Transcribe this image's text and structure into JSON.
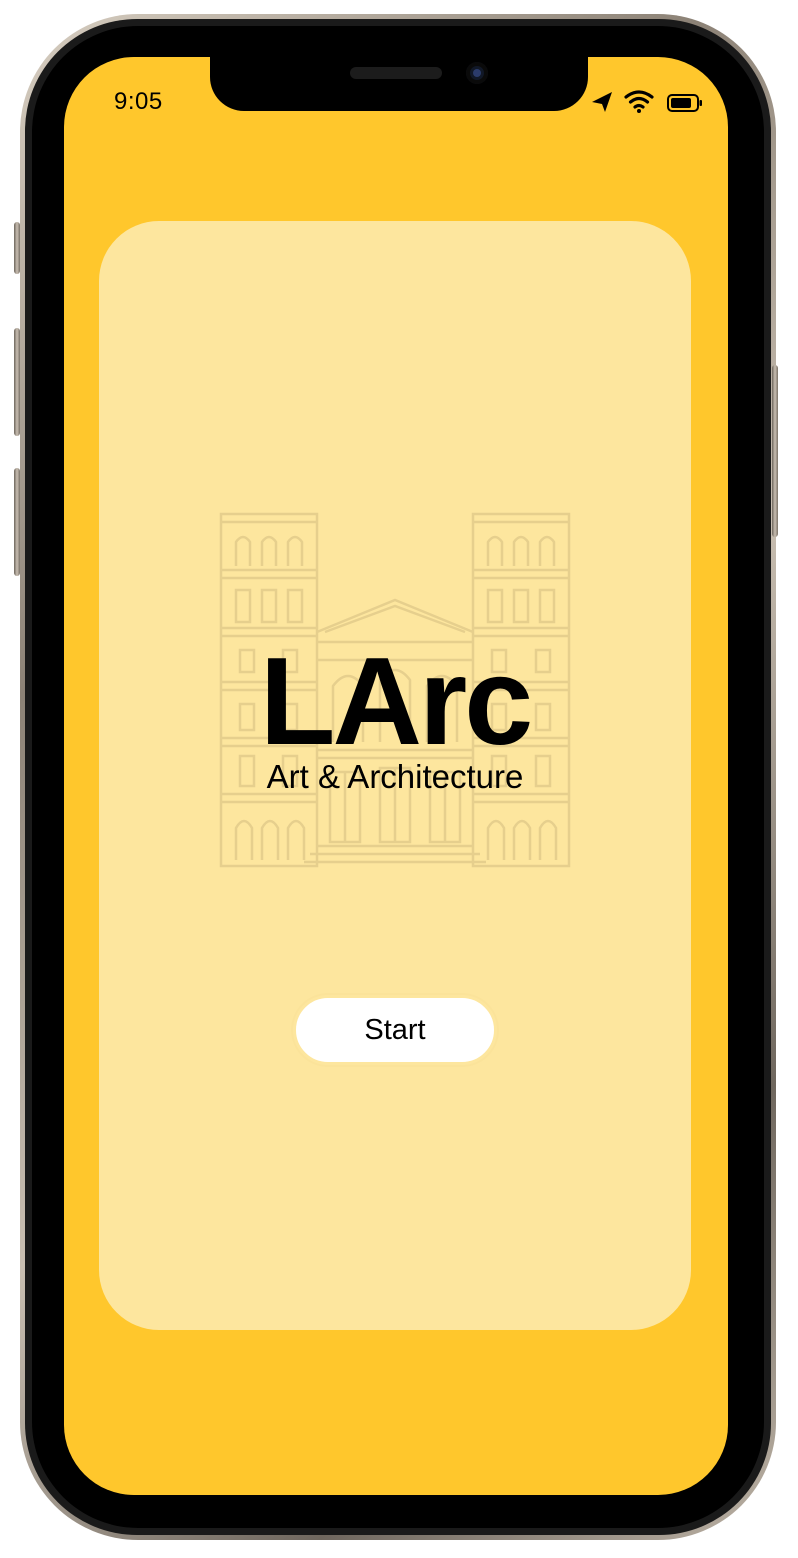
{
  "status_bar": {
    "time": "9:05",
    "icons": [
      "location-arrow-icon",
      "wifi-icon",
      "battery-icon"
    ]
  },
  "splash": {
    "title": "LArc",
    "subtitle": "Art & Architecture",
    "background_image": "cathedral-facade-icon"
  },
  "start_button": {
    "label": "Start"
  },
  "colors": {
    "screen_background": "#ffc72c",
    "card_background": "#fde69e",
    "button_background": "#ffffff",
    "text": "#000000"
  }
}
